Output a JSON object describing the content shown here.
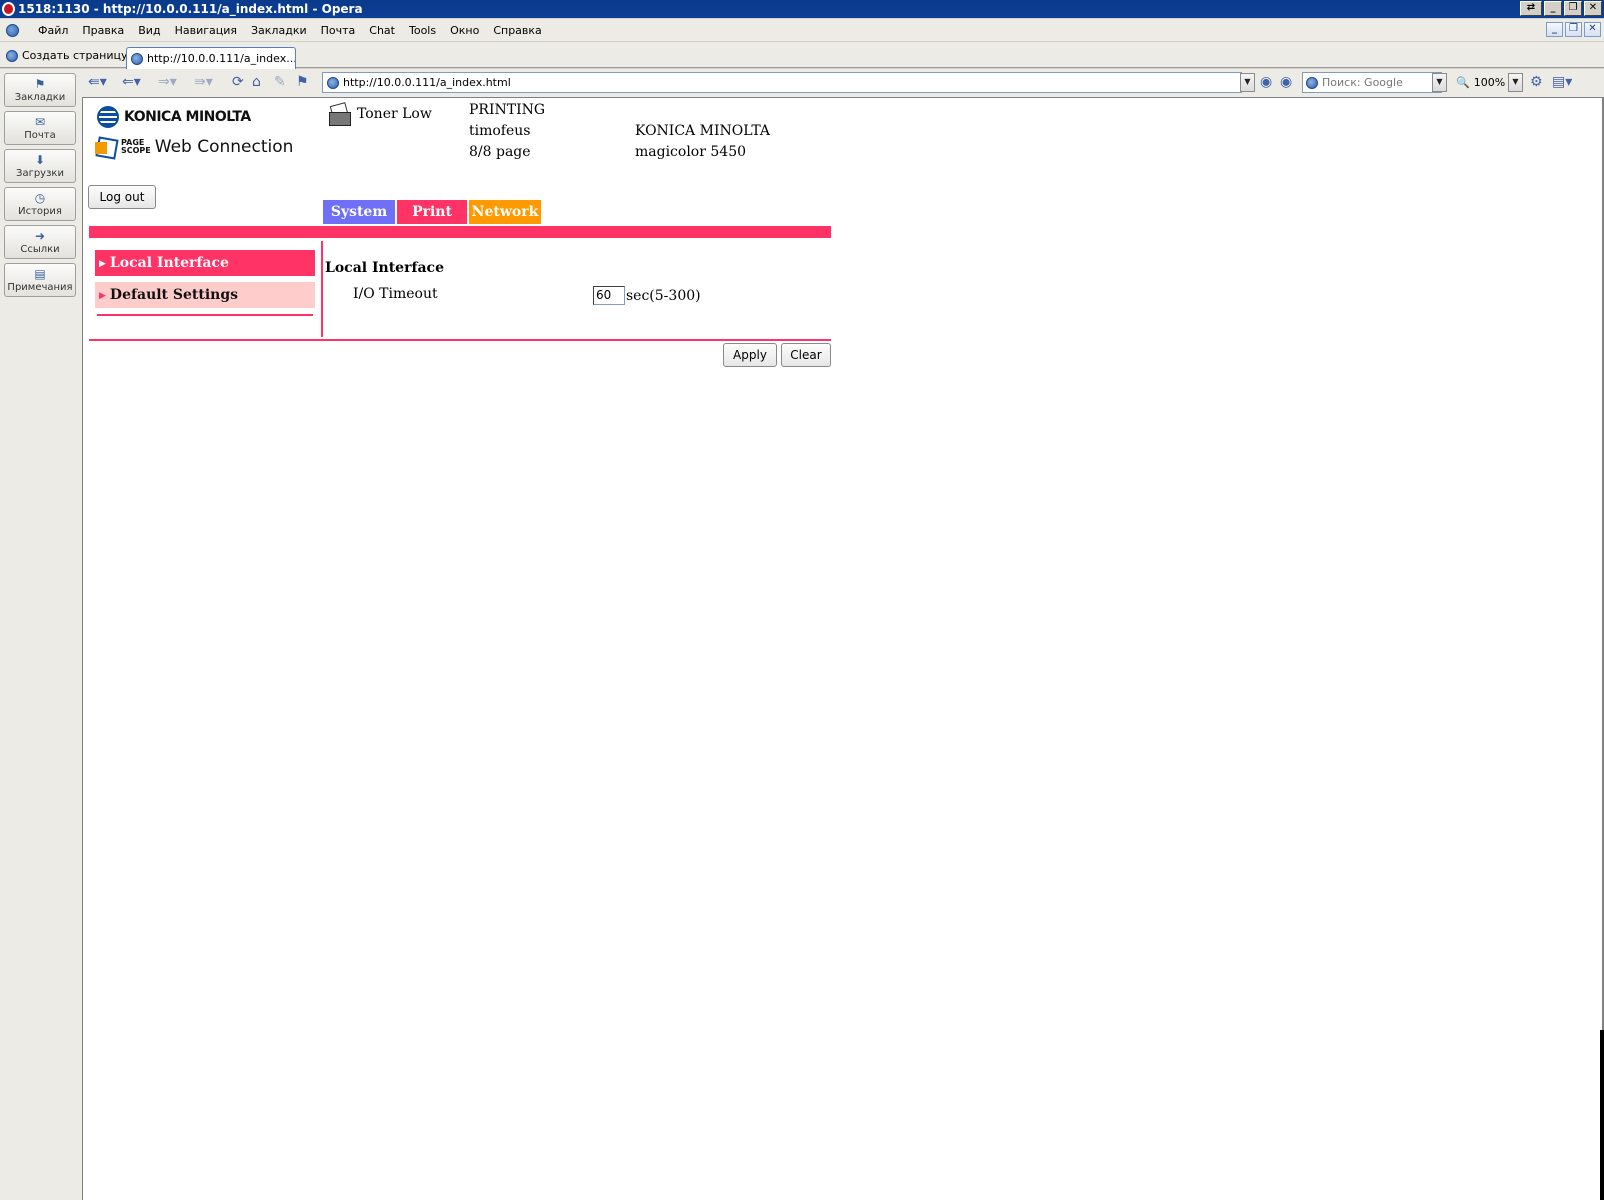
{
  "window": {
    "title": "1518:1130 - http://10.0.0.111/a_index.html - Opera"
  },
  "menu": [
    "Файл",
    "Правка",
    "Вид",
    "Навигация",
    "Закладки",
    "Почта",
    "Chat",
    "Tools",
    "Окно",
    "Справка"
  ],
  "tabs": {
    "new_page": "Создать страницу",
    "active_tab": "http://10.0.0.111/a_index..."
  },
  "sidebar": [
    "Закладки",
    "Почта",
    "Загрузки",
    "История",
    "Ссылки",
    "Примечания"
  ],
  "toolbar": {
    "address": "http://10.0.0.111/a_index.html",
    "search_placeholder": "Поиск: Google",
    "zoom": "100%"
  },
  "page": {
    "brand": "KONICA MINOLTA",
    "ps_line1": "PAGE",
    "ps_line2": "SCOPE",
    "product": "Web Connection",
    "toner_status": "Toner Low",
    "state": "PRINTING",
    "user": "timofeus",
    "pages": "8/8 page",
    "model_brand": "KONICA MINOLTA",
    "model_name": "magicolor 5450",
    "logout": "Log out",
    "main_tabs": [
      "System",
      "Print",
      "Network"
    ],
    "left_nav": [
      "Local Interface",
      "Default Settings"
    ],
    "section_title": "Local Interface",
    "field_label": "I/O Timeout",
    "field_value": "60",
    "field_unit": "sec(5-300)",
    "apply": "Apply",
    "clear": "Clear"
  },
  "colors": {
    "pink": "#ff3366",
    "system_tab": "#6f6ff8",
    "network_tab": "#ff9900",
    "pink_light": "#ffcccc"
  }
}
